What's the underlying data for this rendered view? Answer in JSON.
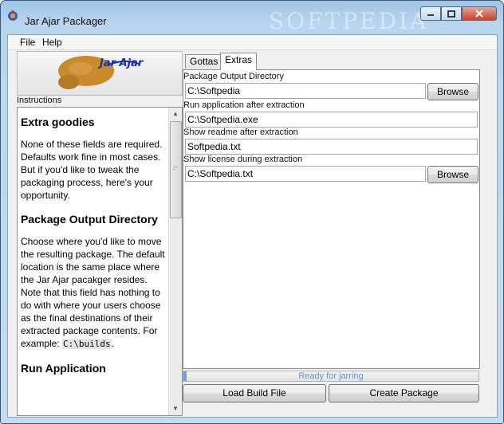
{
  "window": {
    "title": "Jar Ajar Packager",
    "watermark": "SOFTPEDIA"
  },
  "menu": {
    "file": "File",
    "help": "Help"
  },
  "logo": {
    "text": "Jar Ajar"
  },
  "instructions": {
    "label": "Instructions",
    "heading1": "Extra goodies",
    "para1": "None of these fields are required. Defaults work fine in most cases. But if you'd like to tweak the packaging process, here's your opportunity.",
    "heading2": "Package Output Directory",
    "para2": "Choose where you'd like to move the resulting package. The default location is the same place where the Jar Ajar pacakger resides. Note that this field has nothing to do with where your users choose as the final destinations of their extracted package contents. For example:",
    "code_example": "C:\\builds",
    "code_suffix": ".",
    "heading3": "Run Application"
  },
  "tabs": {
    "gottas": "Gottas",
    "extras": "Extras"
  },
  "fields": {
    "output_dir_label": "Package Output Directory",
    "output_dir_value": "C:\\Softpedia",
    "run_app_label": "Run application after extraction",
    "run_app_value": "C:\\Softpedia.exe",
    "readme_label": "Show readme after extraction",
    "readme_value": "Softpedia.txt",
    "license_label": "Show license during extraction",
    "license_value": "C:\\Softpedia.txt"
  },
  "buttons": {
    "browse": "Browse",
    "load_build": "Load Build File",
    "create_package": "Create Package"
  },
  "status": {
    "text": "Ready for jarring",
    "progress": 0.01
  },
  "colors": {
    "logo_brown": "#c98a2b",
    "logo_blue": "#1f2f9c",
    "status_text": "#6894c4"
  }
}
